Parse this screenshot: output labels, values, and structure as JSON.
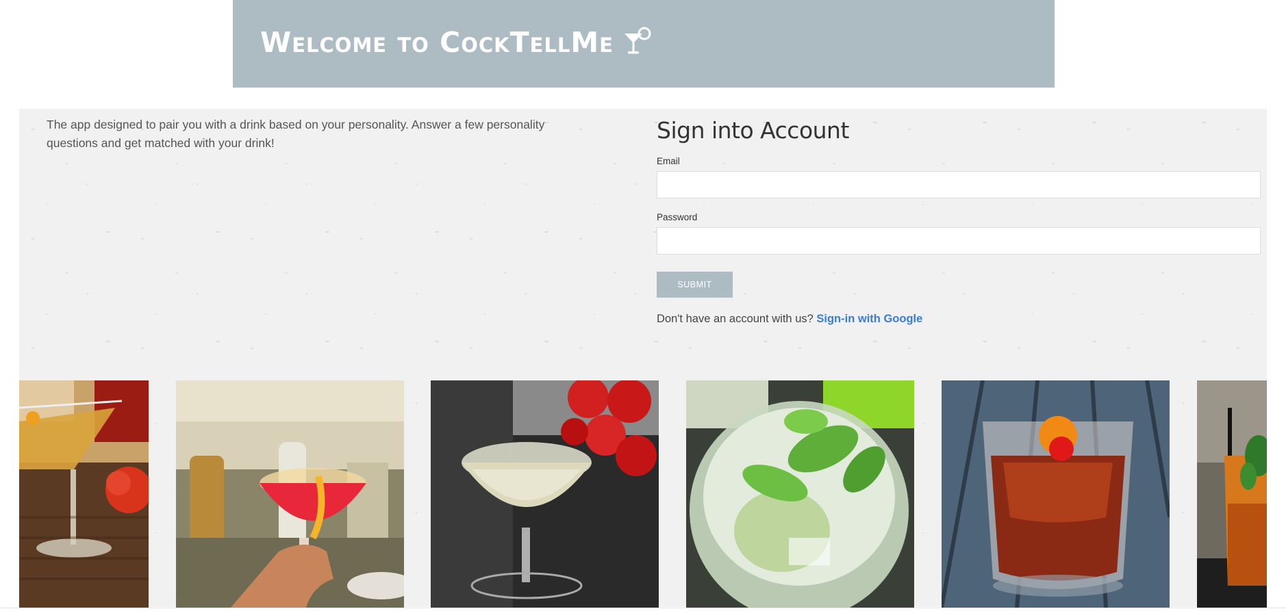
{
  "header": {
    "title": "Welcome to CockTellMe",
    "logo_icon": "cocktail-glass-icon"
  },
  "intro": {
    "text": "The app designed to pair you with a drink based on your personality. Answer a few personality questions and get matched with your drink!"
  },
  "signin": {
    "heading": "Sign into Account",
    "email_label": "Email",
    "email_value": "",
    "password_label": "Password",
    "password_value": "",
    "submit_label": "SUBMIT",
    "account_prompt": "Don't have an account with us?",
    "google_link": "Sign-in with Google"
  },
  "gallery": {
    "photos": [
      "martini-photo",
      "red-coupe-cocktail-photo",
      "champagne-coupe-photo",
      "mojito-photo",
      "negroni-photo",
      "tall-cocktail-photo"
    ]
  },
  "colors": {
    "header_bg": "#adbcc3",
    "panel_bg": "#f1f1f1",
    "link": "#3b7bd8",
    "button_bg": "#adbcc3"
  }
}
